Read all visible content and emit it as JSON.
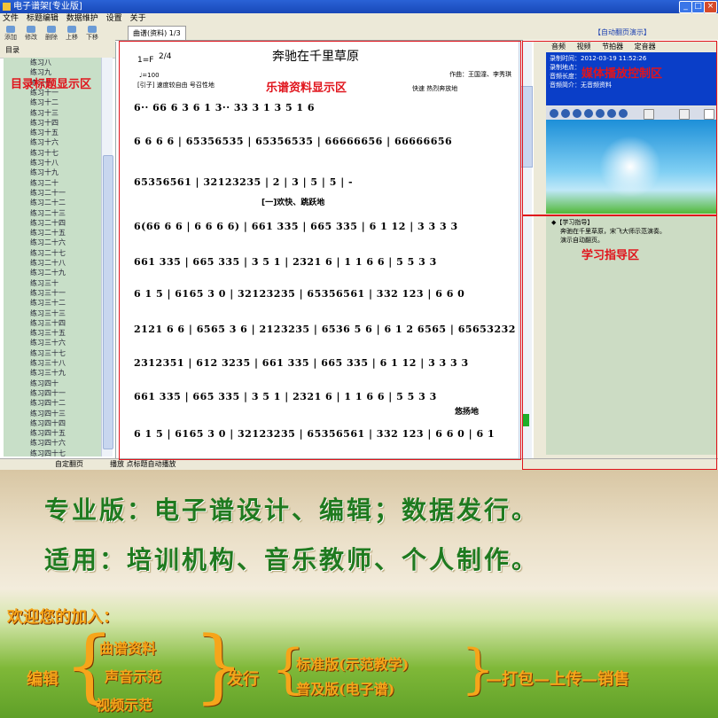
{
  "window": {
    "title": "电子谱架[专业版]"
  },
  "menu": [
    "文件",
    "标题编辑",
    "数据维护",
    "设置",
    "关于"
  ],
  "toolbar": [
    "添加",
    "修改",
    "删除",
    "上移",
    "下移"
  ],
  "doc_tab": "曲谱(资料) 1/3",
  "right_header": "【自动翻页演示】",
  "tree": {
    "root": "目录",
    "items": [
      "练习八",
      "练习九",
      "练习十",
      "练习十一",
      "练习十二",
      "练习十三",
      "练习十四",
      "练习十五",
      "练习十六",
      "练习十七",
      "练习十八",
      "练习十九",
      "练习二十",
      "练习二十一",
      "练习二十二",
      "练习二十三",
      "练习二十四",
      "练习二十五",
      "练习二十六",
      "练习二十七",
      "练习二十八",
      "练习二十九",
      "练习三十",
      "练习三十一",
      "练习三十二",
      "练习三十三",
      "练习三十四",
      "练习三十五",
      "练习三十六",
      "练习三十七",
      "练习三十八",
      "练习三十九",
      "练习四十",
      "练习四十一",
      "练习四十二",
      "练习四十三",
      "练习四十四",
      "练习四十五",
      "练习四十六",
      "练习四十七"
    ],
    "selected": "自动翻页演示"
  },
  "score": {
    "title": "奔驰在千里草原",
    "key": "1=F",
    "meter": "2/4",
    "tempo": "♩=100",
    "intro_label": "[引子]  速度较自由  号召性地",
    "composer": "作曲：王国潼、李秀琪",
    "tempo2": "快速  热烈奔放地",
    "section": "[一]欢快、跳跃地",
    "ending": "悠扬地",
    "rows": [
      "6··  66 6 3 6 1 3··  33 3 1 3 5  1  6",
      "6   6   6   6  | 65356535 | 65356535 | 66666656 | 66666656",
      "65356561 | 32123235 | 2 | 3 | 5 | 5 | -",
      "6(66 6 6 | 6 6 6 6) | 661 335 | 665 335 | 6 1 12 | 3 3 3 3",
      "661 335 | 665 335 | 3 5 1 | 2321 6 | 1 1 6 6 | 5 5 3 3",
      "6 1 5 | 6165 3 0 | 32123235 | 65356561 | 332 123 | 6 6 0",
      "2121 6 6 | 6565 3 6 | 2123235 | 6536 5 6 | 6 1 2 6565 | 65653232",
      "2312351 | 612 3235 | 661 335 | 665 335 | 6 1 12 | 3 3 3 3",
      "661 335 | 665 335 | 3 5 1 | 2321 6 | 1 1 6 6 | 5 5 3 3",
      "6 1 5 | 6165 3 0 | 32123235 | 65356561 | 332 123 | 6 6 0 | 6 1"
    ]
  },
  "media": {
    "tabs": [
      "音频",
      "视频",
      "节拍器",
      "定音器"
    ],
    "info": [
      "录制时间：2012-03-19 11:52:26",
      "录制地点：",
      "音频长度：",
      "音频简介：无音频资料"
    ]
  },
  "guide": {
    "title": "◆【学习指导】",
    "lines": [
      "奔驰在千里草原，宋飞大师示范演奏。",
      "演示自动翻页。"
    ]
  },
  "status": {
    "left": "自定翻页",
    "mid": "播放  点标题自动播放"
  },
  "labels": {
    "tree": "目录标题显示区",
    "score": "乐谱资料显示区",
    "media": "媒体播放控制区",
    "guide": "学习指导区"
  },
  "ad": {
    "line1": "专业版：电子谱设计、编辑；数据发行。",
    "line2": "适用：培训机构、音乐教师、个人制作。",
    "welcome": "欢迎您的加入：",
    "edit": "编辑",
    "edit_items": [
      "曲谱资料",
      "声音示范",
      "视频示范"
    ],
    "publish": "发行",
    "publish_items": [
      "标准版(示范教学)",
      "普及版(电子谱)"
    ],
    "flow": "—打包—上传—销售"
  }
}
